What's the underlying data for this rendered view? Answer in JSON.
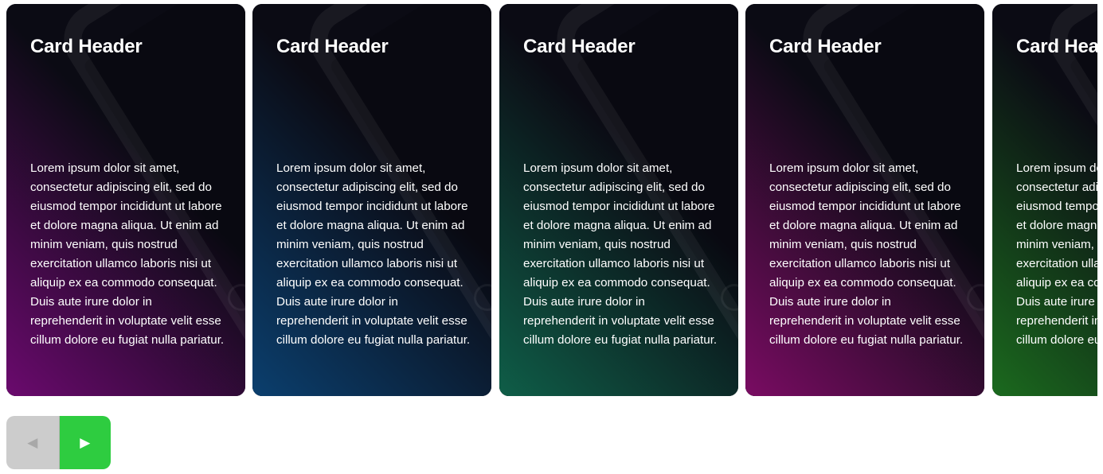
{
  "carousel": {
    "cards": [
      {
        "header": "Card Header",
        "body": "Lorem ipsum dolor sit amet, consectetur adipiscing elit, sed do eiusmod tempor incididunt ut labore et dolore magna aliqua. Ut enim ad minim veniam, quis nostrud exercitation ullamco laboris nisi ut aliquip ex ea commodo consequat. Duis aute irure dolor in reprehenderit in voluptate velit esse cillum dolore eu fugiat nulla pariatur.",
        "color": "#6b0a6e"
      },
      {
        "header": "Card Header",
        "body": "Lorem ipsum dolor sit amet, consectetur adipiscing elit, sed do eiusmod tempor incididunt ut labore et dolore magna aliqua. Ut enim ad minim veniam, quis nostrud exercitation ullamco laboris nisi ut aliquip ex ea commodo consequat. Duis aute irure dolor in reprehenderit in voluptate velit esse cillum dolore eu fugiat nulla pariatur.",
        "color": "#0b3f6e"
      },
      {
        "header": "Card Header",
        "body": "Lorem ipsum dolor sit amet, consectetur adipiscing elit, sed do eiusmod tempor incididunt ut labore et dolore magna aliqua. Ut enim ad minim veniam, quis nostrud exercitation ullamco laboris nisi ut aliquip ex ea commodo consequat. Duis aute irure dolor in reprehenderit in voluptate velit esse cillum dolore eu fugiat nulla pariatur.",
        "color": "#0f5e48"
      },
      {
        "header": "Card Header",
        "body": "Lorem ipsum dolor sit amet, consectetur adipiscing elit, sed do eiusmod tempor incididunt ut labore et dolore magna aliqua. Ut enim ad minim veniam, quis nostrud exercitation ullamco laboris nisi ut aliquip ex ea commodo consequat. Duis aute irure dolor in reprehenderit in voluptate velit esse cillum dolore eu fugiat nulla pariatur.",
        "color": "#7a0c63"
      },
      {
        "header": "Card Header",
        "body": "Lorem ipsum dolor sit amet, consectetur adipiscing elit, sed do eiusmod tempor incididunt ut labore et dolore magna aliqua. Ut enim ad minim veniam, quis nostrud exercitation ullamco laboris nisi ut aliquip ex ea commodo consequat. Duis aute irure dolor in reprehenderit in voluptate velit esse cillum dolore eu fugiat nulla pariatur.",
        "color": "#1b6a1e"
      }
    ]
  },
  "nav": {
    "prev_label": "◀",
    "next_label": "▶",
    "prev_color": "#cccccc",
    "next_color": "#2ecc40"
  }
}
